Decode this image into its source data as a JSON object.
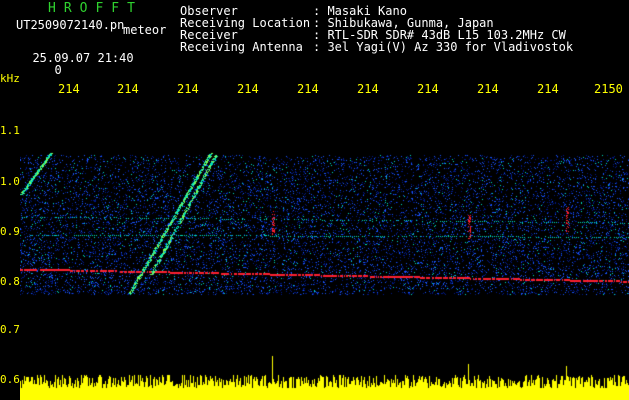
{
  "header": {
    "app_title": "HROFFT",
    "filename": "UT2509072140.pn",
    "mark_label": "meteor",
    "datetime": "25.09.07 21:40",
    "counter": "0",
    "fields": [
      {
        "label": "Observer",
        "value": ": Masaki Kano"
      },
      {
        "label": "Receiving Location",
        "value": ": Shibukawa, Gunma, Japan"
      },
      {
        "label": "Receiver",
        "value": ": RTL-SDR SDR# 43dB L15 103.2MHz CW"
      },
      {
        "label": "Receiving Antenna",
        "value": ": 3el Yagi(V) Az 330 for Vladivostok"
      }
    ]
  },
  "axis": {
    "y_unit": "kHz",
    "y_ticks": [
      "1.1",
      "1.0",
      "0.9",
      "0.8",
      "0.7",
      "0.6"
    ],
    "x_ticks": [
      "214",
      "214",
      "214",
      "214",
      "214",
      "214",
      "214",
      "214",
      "214",
      "2150"
    ]
  },
  "colors": {
    "background": "#000000",
    "axis_text": "#ffff00",
    "title": "#2fd22f",
    "noise_low": "#001a8a",
    "noise_mid": "#1a55ff",
    "echo": "#00e0c0",
    "strong": "#ff2030",
    "bars": "#ffff00"
  }
}
